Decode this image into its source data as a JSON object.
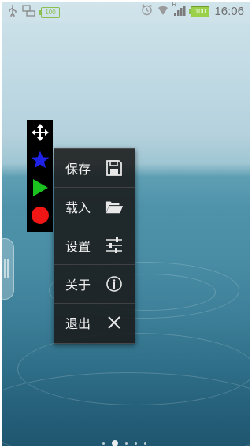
{
  "status_bar": {
    "time": "16:06",
    "battery_left": "100",
    "battery_right": "100",
    "signal_label": "R"
  },
  "toolbar": {
    "items": [
      {
        "icon": "move-arrows-icon",
        "color": "#ffffff"
      },
      {
        "icon": "star-icon",
        "color": "#1e22e6"
      },
      {
        "icon": "play-icon",
        "color": "#19c21f"
      },
      {
        "icon": "record-dot-icon",
        "color": "#f01616"
      }
    ]
  },
  "menu": {
    "items": [
      {
        "label": "保存",
        "icon": "save-icon"
      },
      {
        "label": "载入",
        "icon": "folder-open-icon"
      },
      {
        "label": "设置",
        "icon": "sliders-icon"
      },
      {
        "label": "关于",
        "icon": "info-icon"
      },
      {
        "label": "退出",
        "icon": "close-icon"
      }
    ]
  },
  "page_indicator": {
    "count": 5,
    "active_index": 1
  }
}
